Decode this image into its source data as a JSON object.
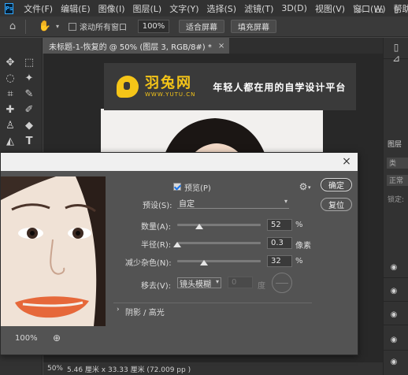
{
  "menubar": {
    "app_icon": "Ps",
    "items": [
      "文件(F)",
      "编辑(E)",
      "图像(I)",
      "图层(L)",
      "文字(Y)",
      "选择(S)",
      "滤镜(T)",
      "3D(D)",
      "视图(V)",
      "窗口(W)",
      "帮助(H)"
    ]
  },
  "options": {
    "scroll_all_label": "滚动所有窗口",
    "zoom_value": "100%",
    "fit_screen_label": "适合屏幕",
    "fill_screen_label": "填充屏幕"
  },
  "document_tab": {
    "title": "未标题-1-恢复的 @ 50% (图层 3, RGB/8#) *",
    "close": "×"
  },
  "banner": {
    "brand_cn": "羽兔网",
    "brand_url": "WWW.YUTU.CN",
    "slogan": "年轻人都在用的自学设计平台"
  },
  "right_panel": {
    "layers_label": "图层",
    "search_label": "类",
    "blend_label": "正常",
    "lock_label": "锁定:"
  },
  "statusbar": {
    "zoom": "50%",
    "doc_info": "5.46 厘米 x 33.33 厘米 (72.009 pp )"
  },
  "dialog": {
    "close": "×",
    "preview_label": "预览(P)",
    "preview_checked": true,
    "ok_label": "确定",
    "reset_label": "复位",
    "preset_label": "预设(S):",
    "preset_value": "自定",
    "amount_label": "数量(A):",
    "amount_value": "52",
    "amount_unit": "%",
    "amount_fraction": 0.26,
    "radius_label": "半径(R):",
    "radius_value": "0.3",
    "radius_unit": "像素",
    "radius_fraction": 0.0,
    "noise_label": "减少杂色(N):",
    "noise_value": "32",
    "noise_unit": "%",
    "noise_fraction": 0.32,
    "remove_label": "移去(V):",
    "remove_value": "镜头模糊",
    "angle_value": "0",
    "angle_unit": "度",
    "shadows_label": "阴影 / 高光",
    "preview_zoom": "100%"
  },
  "colors": {
    "brand_yellow": "#f5c518",
    "panel_bg": "#535353",
    "app_bg": "#323232"
  }
}
